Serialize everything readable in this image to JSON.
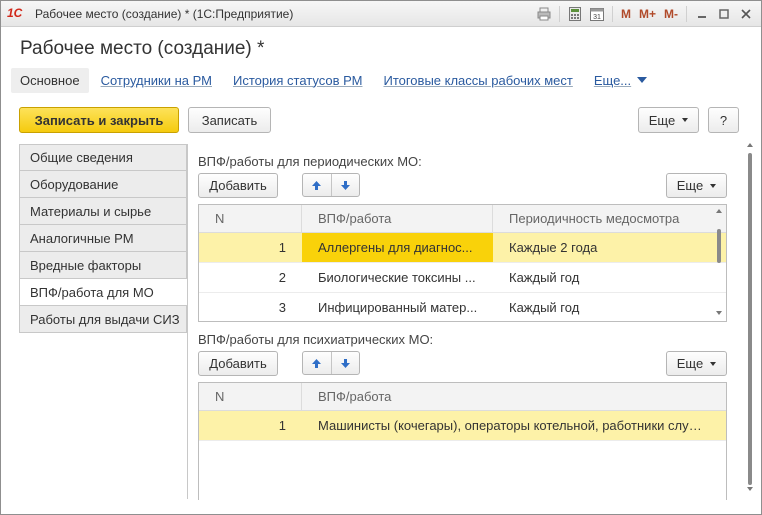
{
  "window": {
    "logo": "1С",
    "title": "Рабочее место (создание) * (1С:Предприятие)",
    "toolbar": {
      "m": "M",
      "m_plus": "M+",
      "m_minus": "M-",
      "calendar": "31"
    }
  },
  "form": {
    "title": "Рабочее место (создание) *"
  },
  "nav": {
    "items": [
      "Основное",
      "Сотрудники на РМ",
      "История статусов РМ",
      "Итоговые классы рабочих мест"
    ],
    "more": "Еще..."
  },
  "command_bar": {
    "save_close": "Записать и закрыть",
    "save": "Записать",
    "more": "Еще",
    "help": "?"
  },
  "tabs": [
    "Общие сведения",
    "Оборудование",
    "Материалы и сырье",
    "Аналогичные РМ",
    "Вредные факторы",
    "ВПФ/работа для МО",
    "Работы для выдачи СИЗ"
  ],
  "periodic": {
    "label": "ВПФ/работы для периодических МО:",
    "add": "Добавить",
    "more": "Еще",
    "columns": [
      "N",
      "ВПФ/работа",
      "Периодичность медосмотра"
    ],
    "rows": [
      {
        "n": "1",
        "work": "Аллергены для диагнос...",
        "period": "Каждые 2 года"
      },
      {
        "n": "2",
        "work": "Биологические токсины ...",
        "period": "Каждый год"
      },
      {
        "n": "3",
        "work": "Инфицированный матер...",
        "period": "Каждый год"
      }
    ]
  },
  "psych": {
    "label": "ВПФ/работы для психиатрических МО:",
    "add": "Добавить",
    "more": "Еще",
    "columns": [
      "N",
      "ВПФ/работа"
    ],
    "rows": [
      {
        "n": "1",
        "work": "Машинисты (кочегары), операторы котельной, работники служ..."
      }
    ]
  },
  "colors": {
    "accent_yellow": "#f5cb0e",
    "selected_row": "#fdf2a8",
    "link": "#2a5a9f"
  }
}
